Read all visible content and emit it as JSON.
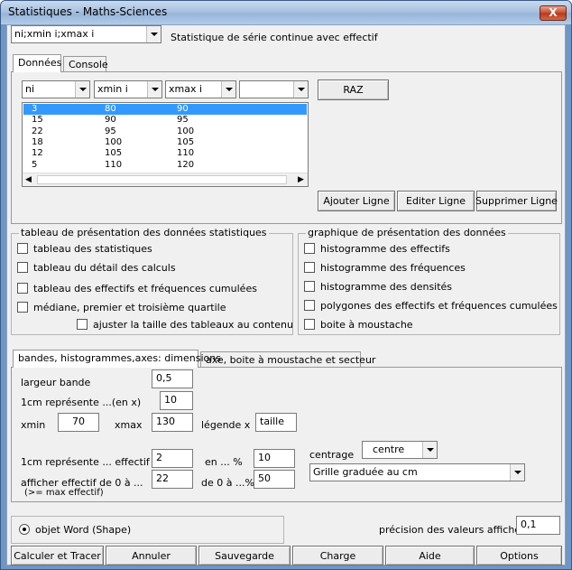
{
  "window": {
    "title": "Statistiques - Maths-Sciences",
    "close_label": "X"
  },
  "top": {
    "series_combo": "ni;xmin i;xmax i",
    "series_desc": "Statistique de série continue avec effectif"
  },
  "tabs_top": [
    {
      "label": "Données"
    },
    {
      "label": "Console"
    }
  ],
  "data_columns": [
    "ni",
    "xmin i",
    "xmax i",
    ""
  ],
  "raz_label": "RAZ",
  "table_rows": [
    {
      "ni": "3",
      "xmin": "80",
      "xmax": "90"
    },
    {
      "ni": "15",
      "xmin": "90",
      "xmax": "95"
    },
    {
      "ni": "22",
      "xmin": "95",
      "xmax": "100"
    },
    {
      "ni": "18",
      "xmin": "100",
      "xmax": "105"
    },
    {
      "ni": "12",
      "xmin": "105",
      "xmax": "110"
    },
    {
      "ni": "5",
      "xmin": "110",
      "xmax": "120"
    }
  ],
  "row_buttons": {
    "add": "Ajouter Ligne",
    "edit": "Editer Ligne",
    "delete": "Supprimer Ligne"
  },
  "group_tables": {
    "title": "tableau de présentation des données statistiques",
    "items": [
      "tableau des statistiques",
      "tableau du détail des calculs",
      "tableau des effectifs et fréquences cumulées",
      "médiane, premier et troisième quartile",
      "ajuster la taille des tableaux au contenu"
    ]
  },
  "group_graphs": {
    "title": "graphique de présentation des données",
    "items": [
      "histogramme des effectifs",
      "histogramme des fréquences",
      "histogramme des densités",
      "polygones des effectifs et fréquences cumulées",
      "boite à moustache"
    ]
  },
  "tabs_bottom": [
    {
      "label": "bandes, histogrammes,axes: dimensions"
    },
    {
      "label": "axe, boite à moustache et secteur"
    }
  ],
  "dims": {
    "band_width_label": "largeur bande",
    "band_width_value": "0,5",
    "x_scale_label": "1cm représente ...(en x)",
    "x_scale_value": "10",
    "xmin_label": "xmin",
    "xmin_value": "70",
    "xmax_label": "xmax",
    "xmax_value": "130",
    "legend_x_label": "légende x",
    "legend_x_value": "taille",
    "eff_scale_label": "1cm représente ... effectif",
    "eff_scale_value": "2",
    "pct_label": "en ... %",
    "pct_value": "10",
    "show_eff_label": "afficher effectif de 0 à ...",
    "show_eff_sub": "(>= max effectif)",
    "show_eff_value": "22",
    "pct_range_label": "de 0 à ...%",
    "pct_range_value": "50",
    "centering_label": "centrage",
    "centering_value": "centre",
    "grid_value": "Grille graduée au cm"
  },
  "bottom": {
    "word_option": "objet Word (Shape)",
    "precision_label": "précision des valeurs affichées",
    "precision_value": "0,1"
  },
  "actions": [
    "Calculer et Tracer",
    "Annuler",
    "Sauvegarde",
    "Charge",
    "Aide",
    "Options"
  ]
}
